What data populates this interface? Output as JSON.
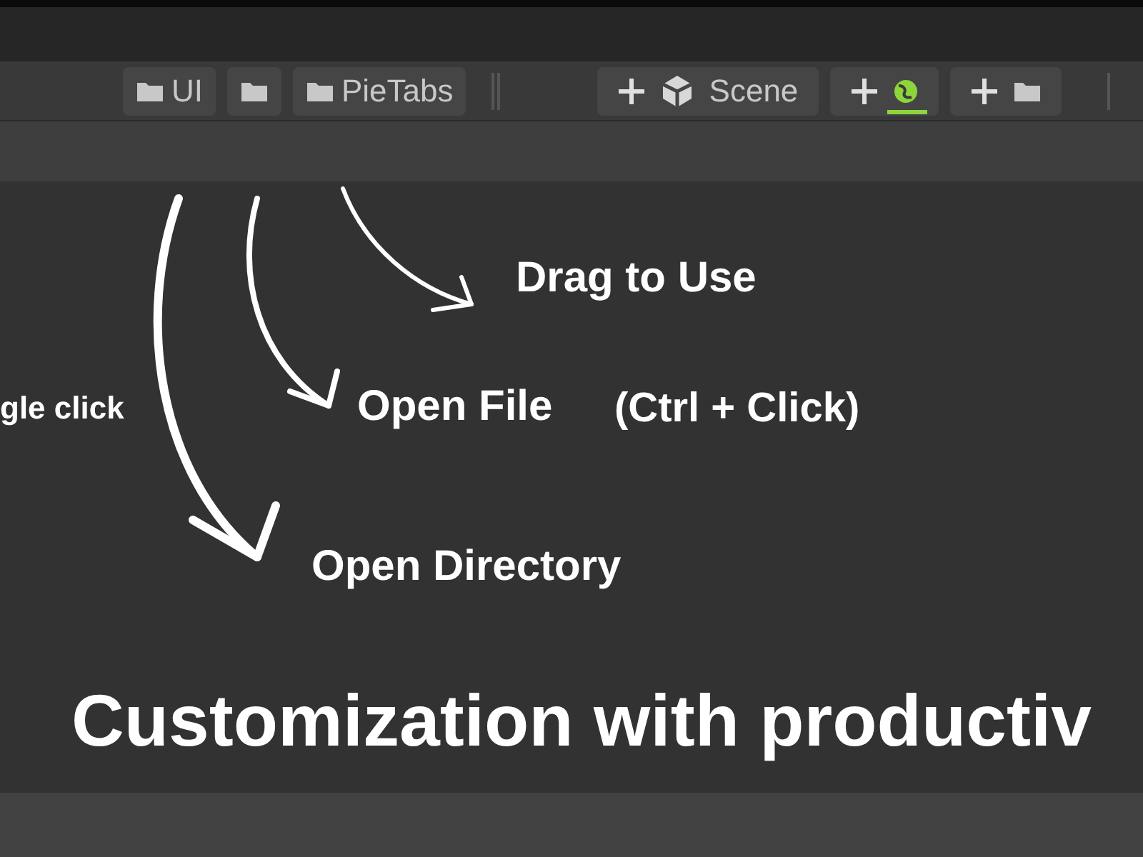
{
  "toolbar": {
    "items": [
      {
        "kind": "folder",
        "label": "UI"
      },
      {
        "kind": "folder"
      },
      {
        "kind": "folder",
        "label": "PieTabs"
      },
      {
        "kind": "separator"
      },
      {
        "kind": "add-scene",
        "label": "Scene",
        "selected": false
      },
      {
        "kind": "add-ball",
        "selected": true
      },
      {
        "kind": "add-folder",
        "selected": false
      },
      {
        "kind": "separator"
      }
    ]
  },
  "annotations": [
    {
      "text": "Drag to Use"
    },
    {
      "text": "gle click"
    },
    {
      "text": "Open File"
    },
    {
      "text": "(Ctrl + Click)"
    },
    {
      "text": "Open Directory"
    }
  ],
  "headline": "Customization with productiv"
}
